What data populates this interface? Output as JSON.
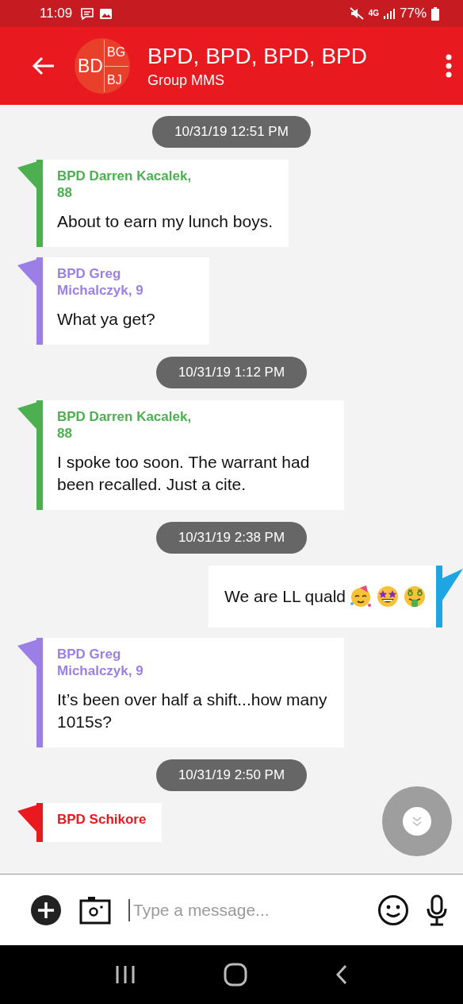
{
  "status_bar": {
    "time": "11:09",
    "network": "4G",
    "battery": "77%"
  },
  "app_bar": {
    "avatar": {
      "main": "BD",
      "top": "BG",
      "bottom": "BJ"
    },
    "title": "BPD, BPD, BPD, BPD",
    "subtitle": "Group MMS"
  },
  "messages": [
    {
      "kind": "date",
      "text": "10/31/19 12:51 PM"
    },
    {
      "kind": "incoming",
      "sender": "BPD Darren Kacalek, 88",
      "color": "#4caf50",
      "text": "About to earn my lunch boys."
    },
    {
      "kind": "incoming",
      "sender": "BPD Greg Michalczyk, 9",
      "color": "#9c7fe6",
      "text": "What ya get?"
    },
    {
      "kind": "date",
      "text": "10/31/19 1:12 PM"
    },
    {
      "kind": "incoming",
      "sender": "BPD Darren Kacalek, 88",
      "color": "#4caf50",
      "text": "I spoke too soon. The warrant had been recalled. Just a cite."
    },
    {
      "kind": "date",
      "text": "10/31/19 2:38 PM"
    },
    {
      "kind": "outgoing",
      "color": "#1ea6e4",
      "text": "We are LL quald",
      "has_emoji": true
    },
    {
      "kind": "incoming",
      "sender": "BPD Greg Michalczyk, 9",
      "color": "#9c7fe6",
      "text": "It’s been over half a shift...how many 1015s?"
    },
    {
      "kind": "date",
      "text": "10/31/19 2:50 PM"
    },
    {
      "kind": "incoming",
      "sender": "BPD Schikore",
      "color": "#e8191f"
    }
  ],
  "composer": {
    "placeholder": "Type a message..."
  }
}
